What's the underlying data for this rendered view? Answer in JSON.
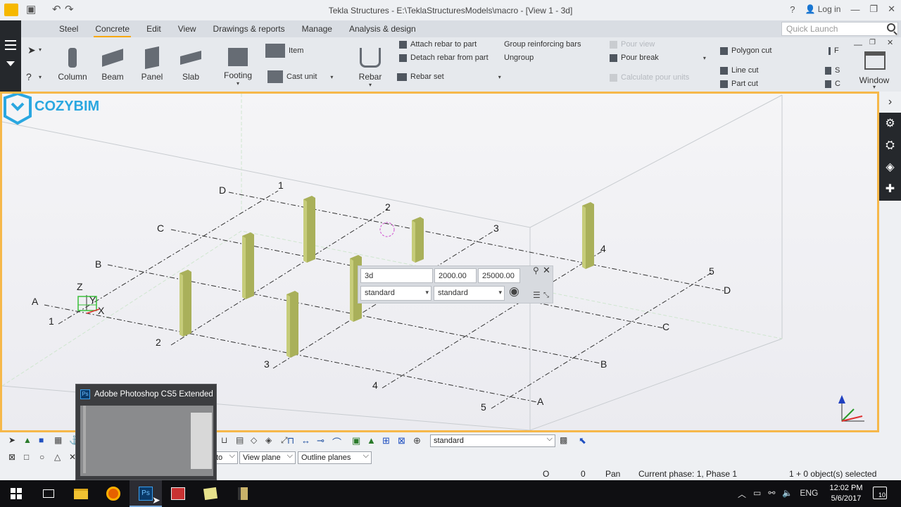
{
  "window": {
    "title": "Tekla Structures - E:\\TeklaStructuresModels\\macro  - [View 1 - 3d]",
    "help_label": "?",
    "login_label": "Log in"
  },
  "tabs": [
    "Steel",
    "Concrete",
    "Edit",
    "View",
    "Drawings & reports",
    "Manage",
    "Analysis & design"
  ],
  "active_tab": "Concrete",
  "quick_launch": {
    "placeholder": "Quick Launch"
  },
  "ribbon": {
    "large": [
      "Column",
      "Beam",
      "Panel",
      "Slab",
      "Footing"
    ],
    "item_label": "Item",
    "cast_unit_label": "Cast unit",
    "rebar_label": "Rebar",
    "attach_rebar": "Attach rebar to part",
    "detach_rebar": "Detach rebar from part",
    "rebar_set": "Rebar set",
    "group_bars": "Group reinforcing bars",
    "ungroup": "Ungroup",
    "pour_view": "Pour view",
    "pour_break": "Pour break",
    "calc_pour": "Calculate pour units",
    "polygon_cut": "Polygon cut",
    "line_cut": "Line cut",
    "part_cut": "Part cut",
    "col_f": "F",
    "col_s": "S",
    "col_c": "C",
    "window_label": "Window"
  },
  "viewport": {
    "grid_labels_letters": [
      "A",
      "B",
      "C",
      "D"
    ],
    "grid_labels_numbers": [
      "1",
      "2",
      "3",
      "4",
      "5"
    ],
    "axes": {
      "z": "Z",
      "y": "Y",
      "x": "X"
    }
  },
  "view_dialog": {
    "view_name": "3d",
    "value1": "2000.00",
    "value2": "25000.00",
    "select1": "standard",
    "select2": "standard"
  },
  "toolbar": {
    "filter_select": "standard",
    "view_plane": "View plane",
    "outline_planes": "Outline planes",
    "auto_partial": "to"
  },
  "status": {
    "o_label": "O",
    "zero": "0",
    "mode": "Pan",
    "phase": "Current phase: 1, Phase 1",
    "selection": "1 + 0 object(s) selected"
  },
  "thumbnail": {
    "title": "Adobe Photoshop CS5 Extended",
    "ps": "Ps"
  },
  "logo": {
    "text": "COZYBIM"
  },
  "taskbar": {
    "language": "ENG",
    "time": "12:02 PM",
    "date": "5/6/2017",
    "notifications": "10"
  }
}
